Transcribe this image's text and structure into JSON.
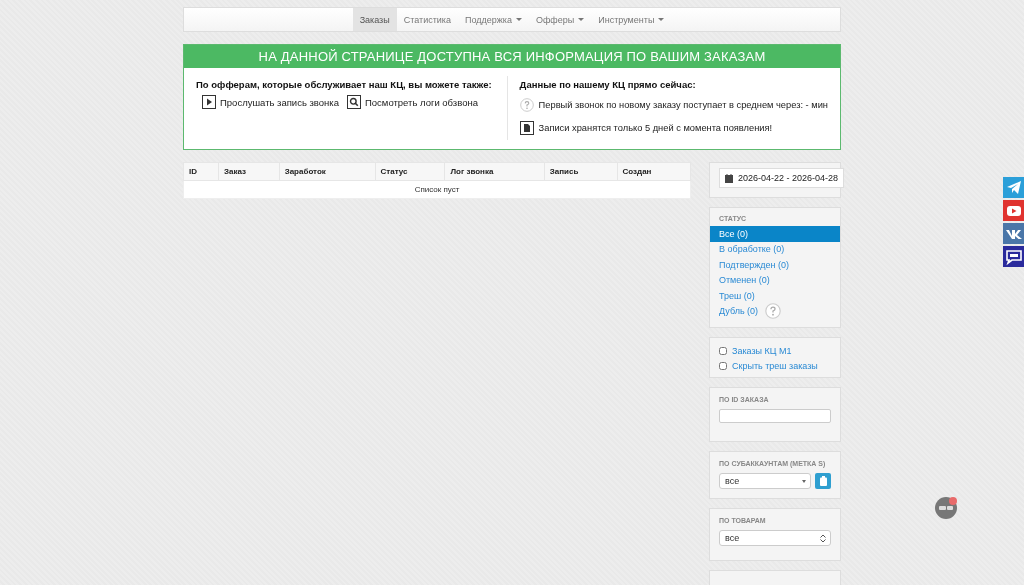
{
  "nav": {
    "items": [
      {
        "label": "Заказы",
        "selected": true,
        "dropdown": false
      },
      {
        "label": "Статистика",
        "selected": false,
        "dropdown": false
      },
      {
        "label": "Поддержка",
        "selected": false,
        "dropdown": true
      },
      {
        "label": "Офферы",
        "selected": false,
        "dropdown": true
      },
      {
        "label": "Инструменты",
        "selected": false,
        "dropdown": true
      }
    ]
  },
  "banner": {
    "title": "НА ДАННОЙ СТРАНИЦЕ ДОСТУПНА ВСЯ ИНФОРМАЦИЯ ПО ВАШИМ ЗАКАЗАМ"
  },
  "info": {
    "left": {
      "heading": "По офферам, которые обслуживает наш КЦ, вы можете также:",
      "links": [
        {
          "kind": "play",
          "label": "Прослушать запись звонка"
        },
        {
          "kind": "search",
          "label": "Посмотреть логи обзвона"
        }
      ]
    },
    "right": {
      "heading": "Данные по нашему КЦ прямо сейчас:",
      "notes": [
        {
          "kind": "help",
          "text": "Первый звонок по новому заказу поступает в среднем через: - мин"
        },
        {
          "kind": "file",
          "text": "Записи хранятся только 5 дней с момента появления!"
        }
      ]
    }
  },
  "table": {
    "columns": [
      "ID",
      "Заказ",
      "Заработок",
      "Статус",
      "Лог звонка",
      "Запись",
      "Создан"
    ],
    "empty_text": "Список пуст"
  },
  "sidebar": {
    "date_range": {
      "value": "2026-04-22 - 2026-04-28"
    },
    "status": {
      "title": "СТАТУС",
      "items": [
        {
          "label": "Все (0)",
          "selected": true,
          "help": false
        },
        {
          "label": "В обработке (0)",
          "selected": false,
          "help": false
        },
        {
          "label": "Подтвержден (0)",
          "selected": false,
          "help": false
        },
        {
          "label": "Отменен (0)",
          "selected": false,
          "help": false
        },
        {
          "label": "Треш (0)",
          "selected": false,
          "help": false
        },
        {
          "label": "Дубль (0)",
          "selected": false,
          "help": true
        }
      ]
    },
    "options": [
      {
        "label": "Заказы КЦ М1",
        "checked": false
      },
      {
        "label": "Скрыть треш заказы",
        "checked": false
      }
    ],
    "order_id": {
      "title": "ПО ID ЗАКАЗА"
    },
    "subaccounts": {
      "title": "ПО СУБАККАУНТАМ (МЕТКА S)",
      "value": "все"
    },
    "products": {
      "title": "ПО ТОВАРАМ",
      "value": "все"
    }
  },
  "social": [
    {
      "kind": "plane",
      "color": "#2b9fd9"
    },
    {
      "kind": "play",
      "color": "#e0332f"
    },
    {
      "kind": "vk",
      "color": "#4a76a8"
    },
    {
      "kind": "chat",
      "color": "#2a2a9c"
    }
  ]
}
